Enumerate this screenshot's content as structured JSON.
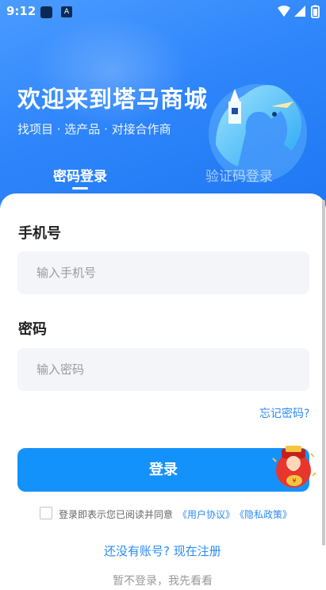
{
  "status_bar": {
    "time": "9:12",
    "app_icon_2_letter": "A"
  },
  "hero": {
    "title": "欢迎来到塔马商城",
    "subtitle": "找项目 · 选产品 · 对接合作商"
  },
  "tabs": [
    {
      "label": "密码登录",
      "active": true
    },
    {
      "label": "验证码登录",
      "active": false
    }
  ],
  "form": {
    "phone_label": "手机号",
    "phone_placeholder": "输入手机号",
    "phone_value": "",
    "password_label": "密码",
    "password_placeholder": "输入密码",
    "password_value": ""
  },
  "forgot_password": "忘记密码?",
  "login_button": "登录",
  "agreement": {
    "checked": false,
    "text": "登录即表示您已阅读并同意",
    "user_agreement": "《用户协议》",
    "privacy_policy": "《隐私政策》"
  },
  "register_link": "还没有账号? 现在注册",
  "browse_link": "暂不登录，我先看看",
  "colors": {
    "hero_blue": "#2f86fb",
    "button_blue": "#1492fb",
    "link_blue": "#2b8bf5",
    "input_bg": "#f4f5f8"
  }
}
